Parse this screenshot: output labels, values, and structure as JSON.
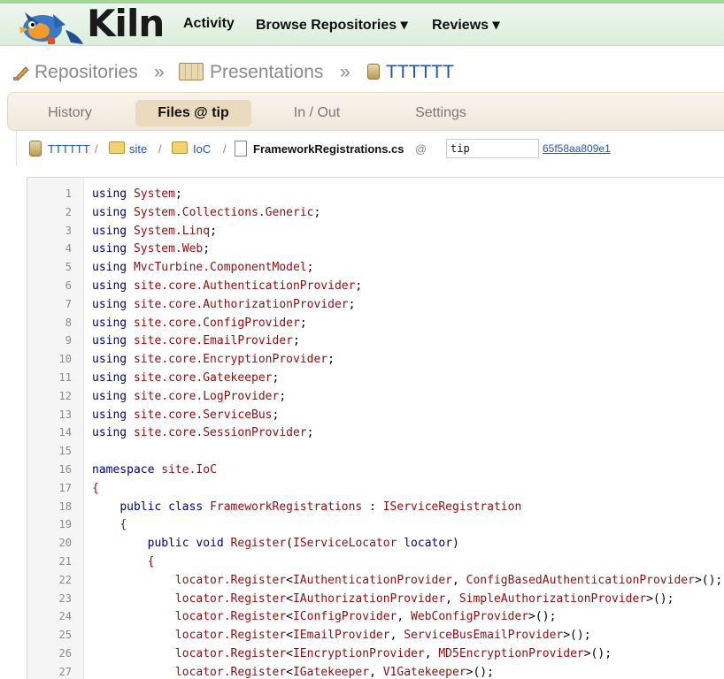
{
  "header": {
    "logo_text": "Kiln",
    "nav": [
      {
        "label": "Activity"
      },
      {
        "label": "Browse Repositories ▾"
      },
      {
        "label": "Reviews ▾"
      }
    ]
  },
  "breadcrumb": {
    "items": [
      "Repositories",
      "Presentations",
      "TTTTTT"
    ],
    "separator": "»"
  },
  "tabs": [
    {
      "label": "History"
    },
    {
      "label": "Files @ tip"
    },
    {
      "label": "In / Out"
    },
    {
      "label": "Settings"
    }
  ],
  "path": {
    "repo": "TTTTTT",
    "folders": [
      "site",
      "IoC"
    ],
    "separator": "/",
    "file": "FrameworkRegistrations.cs",
    "at": "@",
    "rev_value": "tip",
    "hash": "65f58aa809e1"
  },
  "code": [
    {
      "n": "1",
      "t": [
        [
          "kw",
          "using"
        ],
        [
          "pu",
          " "
        ],
        [
          "id",
          "System"
        ],
        [
          "pu",
          ";"
        ]
      ]
    },
    {
      "n": "2",
      "t": [
        [
          "kw",
          "using"
        ],
        [
          "pu",
          " "
        ],
        [
          "id",
          "System.Collections.Generic"
        ],
        [
          "pu",
          ";"
        ]
      ]
    },
    {
      "n": "3",
      "t": [
        [
          "kw",
          "using"
        ],
        [
          "pu",
          " "
        ],
        [
          "id",
          "System.Linq"
        ],
        [
          "pu",
          ";"
        ]
      ]
    },
    {
      "n": "4",
      "t": [
        [
          "kw",
          "using"
        ],
        [
          "pu",
          " "
        ],
        [
          "id",
          "System.Web"
        ],
        [
          "pu",
          ";"
        ]
      ]
    },
    {
      "n": "5",
      "t": [
        [
          "kw",
          "using"
        ],
        [
          "pu",
          " "
        ],
        [
          "id",
          "MvcTurbine.ComponentModel"
        ],
        [
          "pu",
          ";"
        ]
      ]
    },
    {
      "n": "6",
      "t": [
        [
          "kw",
          "using"
        ],
        [
          "pu",
          " "
        ],
        [
          "id",
          "site.core.AuthenticationProvider"
        ],
        [
          "pu",
          ";"
        ]
      ]
    },
    {
      "n": "7",
      "t": [
        [
          "kw",
          "using"
        ],
        [
          "pu",
          " "
        ],
        [
          "id",
          "site.core.AuthorizationProvider"
        ],
        [
          "pu",
          ";"
        ]
      ]
    },
    {
      "n": "8",
      "t": [
        [
          "kw",
          "using"
        ],
        [
          "pu",
          " "
        ],
        [
          "id",
          "site.core.ConfigProvider"
        ],
        [
          "pu",
          ";"
        ]
      ]
    },
    {
      "n": "9",
      "t": [
        [
          "kw",
          "using"
        ],
        [
          "pu",
          " "
        ],
        [
          "id",
          "site.core.EmailProvider"
        ],
        [
          "pu",
          ";"
        ]
      ]
    },
    {
      "n": "10",
      "t": [
        [
          "kw",
          "using"
        ],
        [
          "pu",
          " "
        ],
        [
          "id",
          "site.core.EncryptionProvider"
        ],
        [
          "pu",
          ";"
        ]
      ]
    },
    {
      "n": "11",
      "t": [
        [
          "kw",
          "using"
        ],
        [
          "pu",
          " "
        ],
        [
          "id",
          "site.core.Gatekeeper"
        ],
        [
          "pu",
          ";"
        ]
      ]
    },
    {
      "n": "12",
      "t": [
        [
          "kw",
          "using"
        ],
        [
          "pu",
          " "
        ],
        [
          "id",
          "site.core.LogProvider"
        ],
        [
          "pu",
          ";"
        ]
      ]
    },
    {
      "n": "13",
      "t": [
        [
          "kw",
          "using"
        ],
        [
          "pu",
          " "
        ],
        [
          "id",
          "site.core.ServiceBus"
        ],
        [
          "pu",
          ";"
        ]
      ]
    },
    {
      "n": "14",
      "t": [
        [
          "kw",
          "using"
        ],
        [
          "pu",
          " "
        ],
        [
          "id",
          "site.core.SessionProvider"
        ],
        [
          "pu",
          ";"
        ]
      ]
    },
    {
      "n": "15",
      "t": []
    },
    {
      "n": "16",
      "t": [
        [
          "kw",
          "namespace"
        ],
        [
          "pu",
          " "
        ],
        [
          "id",
          "site.IoC"
        ]
      ]
    },
    {
      "n": "17",
      "t": [
        [
          "id",
          "{"
        ]
      ]
    },
    {
      "n": "18",
      "t": [
        [
          "pu",
          "    "
        ],
        [
          "kw",
          "public class"
        ],
        [
          "pu",
          " "
        ],
        [
          "id",
          "FrameworkRegistrations"
        ],
        [
          "pu",
          " : "
        ],
        [
          "id",
          "IServiceRegistration"
        ]
      ]
    },
    {
      "n": "19",
      "t": [
        [
          "pu",
          "    "
        ],
        [
          "id",
          "{"
        ]
      ]
    },
    {
      "n": "20",
      "t": [
        [
          "pu",
          "        "
        ],
        [
          "kw",
          "public void"
        ],
        [
          "pu",
          " "
        ],
        [
          "id",
          "Register"
        ],
        [
          "pu",
          "("
        ],
        [
          "id",
          "IServiceLocator"
        ],
        [
          "pu",
          " "
        ],
        [
          "kw",
          "locator"
        ],
        [
          "pu",
          ")"
        ]
      ]
    },
    {
      "n": "21",
      "t": [
        [
          "pu",
          "        "
        ],
        [
          "id",
          "{"
        ]
      ]
    },
    {
      "n": "22",
      "t": [
        [
          "pu",
          "            "
        ],
        [
          "id",
          "locator.Register"
        ],
        [
          "pu",
          "<"
        ],
        [
          "id",
          "IAuthenticationProvider"
        ],
        [
          "pu",
          ", "
        ],
        [
          "id",
          "ConfigBasedAuthenticationProvider"
        ],
        [
          "pu",
          ">();"
        ]
      ]
    },
    {
      "n": "23",
      "t": [
        [
          "pu",
          "            "
        ],
        [
          "id",
          "locator.Register"
        ],
        [
          "pu",
          "<"
        ],
        [
          "id",
          "IAuthorizationProvider"
        ],
        [
          "pu",
          ", "
        ],
        [
          "id",
          "SimpleAuthorizationProvider"
        ],
        [
          "pu",
          ">();"
        ]
      ]
    },
    {
      "n": "24",
      "t": [
        [
          "pu",
          "            "
        ],
        [
          "id",
          "locator.Register"
        ],
        [
          "pu",
          "<"
        ],
        [
          "id",
          "IConfigProvider"
        ],
        [
          "pu",
          ", "
        ],
        [
          "id",
          "WebConfigProvider"
        ],
        [
          "pu",
          ">();"
        ]
      ]
    },
    {
      "n": "25",
      "t": [
        [
          "pu",
          "            "
        ],
        [
          "id",
          "locator.Register"
        ],
        [
          "pu",
          "<"
        ],
        [
          "id",
          "IEmailProvider"
        ],
        [
          "pu",
          ", "
        ],
        [
          "id",
          "ServiceBusEmailProvider"
        ],
        [
          "pu",
          ">();"
        ]
      ]
    },
    {
      "n": "26",
      "t": [
        [
          "pu",
          "            "
        ],
        [
          "id",
          "locator.Register"
        ],
        [
          "pu",
          "<"
        ],
        [
          "id",
          "IEncryptionProvider"
        ],
        [
          "pu",
          ", "
        ],
        [
          "id",
          "MD5EncryptionProvider"
        ],
        [
          "pu",
          ">();"
        ]
      ]
    },
    {
      "n": "27",
      "t": [
        [
          "pu",
          "            "
        ],
        [
          "id",
          "locator.Register"
        ],
        [
          "pu",
          "<"
        ],
        [
          "id",
          "IGatekeeper"
        ],
        [
          "pu",
          ", "
        ],
        [
          "id",
          "V1Gatekeeper"
        ],
        [
          "pu",
          ">();"
        ]
      ]
    }
  ],
  "colors": {
    "keyword": "#000080",
    "identifier": "#8b1010",
    "link": "#2456a8",
    "header_green": "#dbeeda",
    "tab_active": "#eadbbd"
  }
}
